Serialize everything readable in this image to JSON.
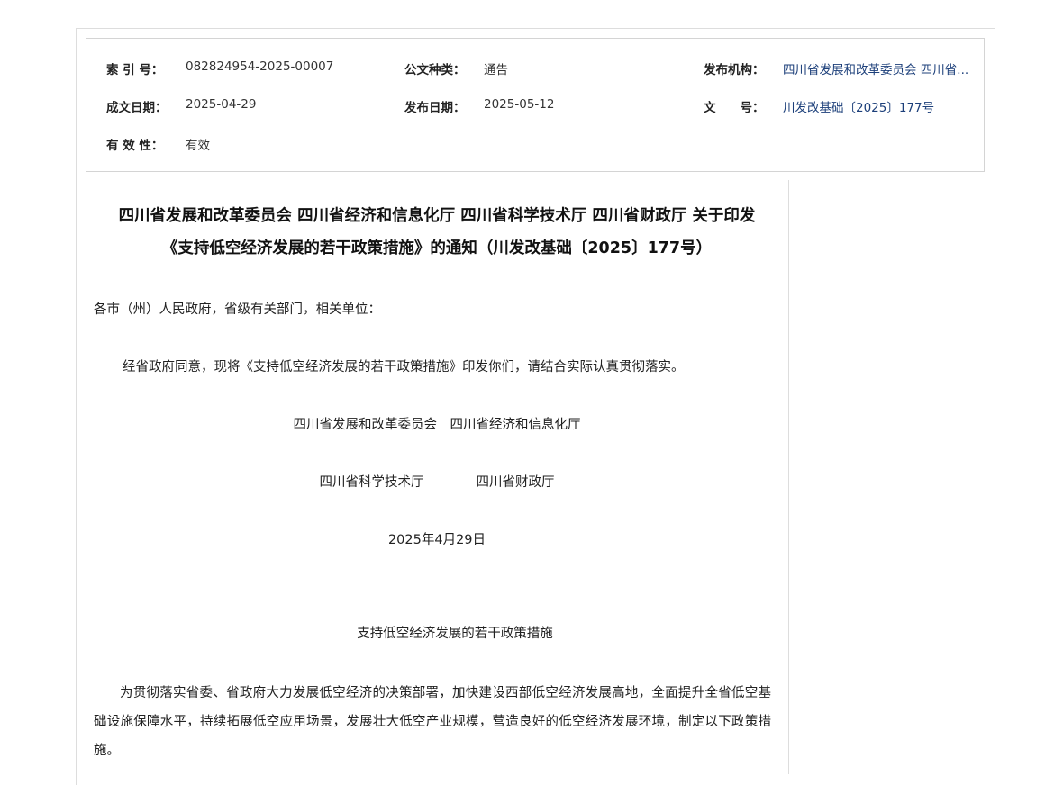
{
  "meta": {
    "index_label": "索 引 号：",
    "index_value": "082824954-2025-00007",
    "type_label": "公文种类：",
    "type_value": "通告",
    "issuer_label": "发布机构：",
    "issuer_value": "四川省发展和改革委员会 四川省...",
    "written_label": "成文日期：",
    "written_value": "2025-04-29",
    "published_label": "发布日期：",
    "published_value": "2025-05-12",
    "docno_label": "文　　号：",
    "docno_value": "川发改基础〔2025〕177号",
    "validity_label": "有 效 性：",
    "validity_value": "有效"
  },
  "article": {
    "title_line1": "四川省发展和改革委员会 四川省经济和信息化厅 四川省科学技术厅 四川省财政厅 关于印发",
    "title_line2": "《支持低空经济发展的若干政策措施》的通知（川发改基础〔2025〕177号）",
    "salutation": "各市（州）人民政府，省级有关部门，相关单位：",
    "intro": "经省政府同意，现将《支持低空经济发展的若干政策措施》印发你们，请结合实际认真贯彻落实。",
    "signers_line1": "四川省发展和改革委员会　四川省经济和信息化厅",
    "signers_line2": "四川省科学技术厅　　　　四川省财政厅",
    "date": "2025年4月29日",
    "subtitle": "支持低空经济发展的若干政策措施",
    "body": "为贯彻落实省委、省政府大力发展低空经济的决策部署，加快建设西部低空经济发展高地，全面提升全省低空基础设施保障水平，持续拓展低空应用场景，发展壮大低空产业规模，营造良好的低空经济发展环境，制定以下政策措施。"
  }
}
